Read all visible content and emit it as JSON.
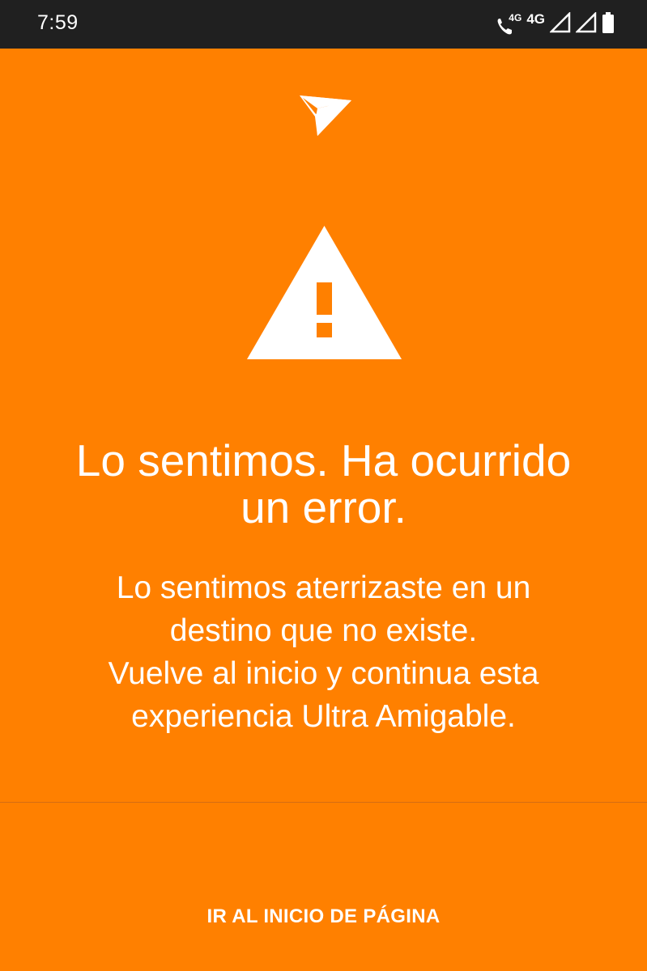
{
  "status_bar": {
    "time": "7:59",
    "network_small_label": "4G",
    "network_label": "4G",
    "icons": [
      "call-wifi-icon",
      "signal-icon",
      "signal-icon",
      "battery-icon"
    ]
  },
  "logo": {
    "icon": "paper-plane-logo-icon"
  },
  "error": {
    "icon": "warning-icon",
    "title_lines": [
      "Lo sentimos. Ha ocurrido",
      "un error."
    ],
    "message_lines": [
      "Lo sentimos aterrizaste en un",
      "destino que no existe.",
      "Vuelve al inicio y continua esta",
      "experiencia Ultra Amigable."
    ]
  },
  "actions": {
    "home_label": "IR AL INICIO DE PÁGINA"
  },
  "colors": {
    "background": "#ff8000",
    "status_bar": "#202020",
    "text": "#ffffff"
  }
}
